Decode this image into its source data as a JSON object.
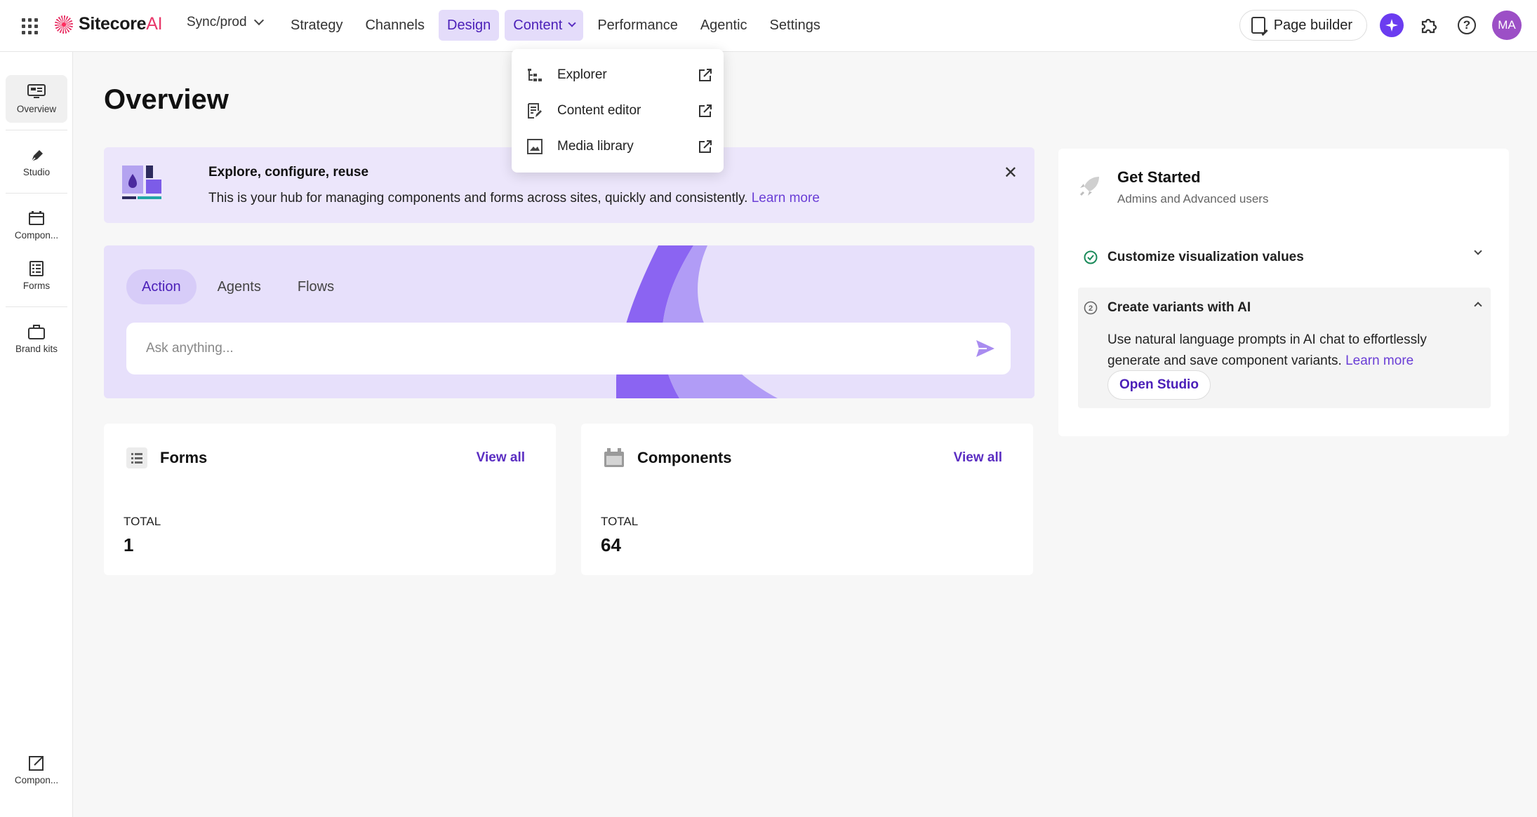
{
  "topbar": {
    "logo_text": "Sitecore",
    "logo_ai": "AI",
    "environment": "Sync/prod",
    "nav": [
      {
        "label": "Strategy"
      },
      {
        "label": "Channels"
      },
      {
        "label": "Design"
      },
      {
        "label": "Content"
      },
      {
        "label": "Performance"
      },
      {
        "label": "Agentic"
      },
      {
        "label": "Settings"
      }
    ],
    "page_builder_label": "Page builder",
    "avatar_initials": "MA",
    "help_glyph": "?"
  },
  "content_menu": {
    "items": [
      {
        "label": "Explorer",
        "icon": "tree-icon"
      },
      {
        "label": "Content editor",
        "icon": "document-edit-icon"
      },
      {
        "label": "Media library",
        "icon": "image-icon"
      }
    ]
  },
  "sidebar": {
    "items": [
      {
        "label": "Overview",
        "icon": "dashboard-icon"
      },
      {
        "label": "Studio",
        "icon": "pen-icon"
      },
      {
        "label": "Compon...",
        "icon": "component-icon"
      },
      {
        "label": "Forms",
        "icon": "form-icon"
      },
      {
        "label": "Brand kits",
        "icon": "briefcase-icon"
      }
    ],
    "bottom_item": {
      "label": "Compon...",
      "icon": "external-link-icon"
    }
  },
  "main": {
    "title": "Overview",
    "banner": {
      "title": "Explore, configure, reuse",
      "text": "This is your hub for managing components and forms across sites, quickly and consistently.",
      "link": "Learn more",
      "close_glyph": "✕"
    },
    "ask": {
      "tabs": [
        {
          "label": "Action"
        },
        {
          "label": "Agents"
        },
        {
          "label": "Flows"
        }
      ],
      "placeholder": "Ask anything..."
    },
    "forms_card": {
      "title": "Forms",
      "link": "View all",
      "total_label": "TOTAL",
      "total": "1"
    },
    "components_card": {
      "title": "Components",
      "link": "View all",
      "total_label": "TOTAL",
      "total": "64"
    }
  },
  "get_started": {
    "title": "Get Started",
    "subtitle": "Admins and Advanced users",
    "rows": [
      {
        "label": "Customize visualization values",
        "status": "completed"
      },
      {
        "label": "Create variants with AI",
        "status": "in-progress"
      }
    ],
    "expanded_text": "Use natural language prompts in AI chat to effortlessly generate and save component variants.",
    "expanded_link": "Learn more",
    "open_studio_label": "Open Studio"
  },
  "colors": {
    "accent": "#6a3ed6",
    "active_nav_bg": "#e4dcfa",
    "banner_bg": "#ece6fb",
    "avatar_bg": "#9c4fc6"
  }
}
